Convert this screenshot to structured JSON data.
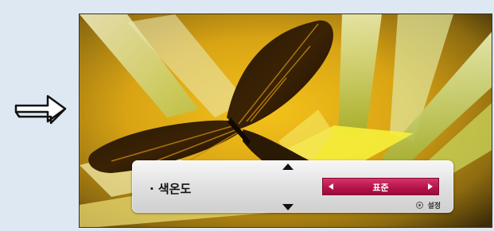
{
  "osd": {
    "setting_label": "· 색온도",
    "value": "표준",
    "hint_label": "설정",
    "accent_color": "#b3124a"
  },
  "icons": {
    "pointer": "arrow-right-icon",
    "prev": "triangle-left-icon",
    "next": "triangle-right-icon",
    "up": "triangle-up-icon",
    "down": "triangle-down-icon",
    "ok": "ok-button-icon"
  }
}
